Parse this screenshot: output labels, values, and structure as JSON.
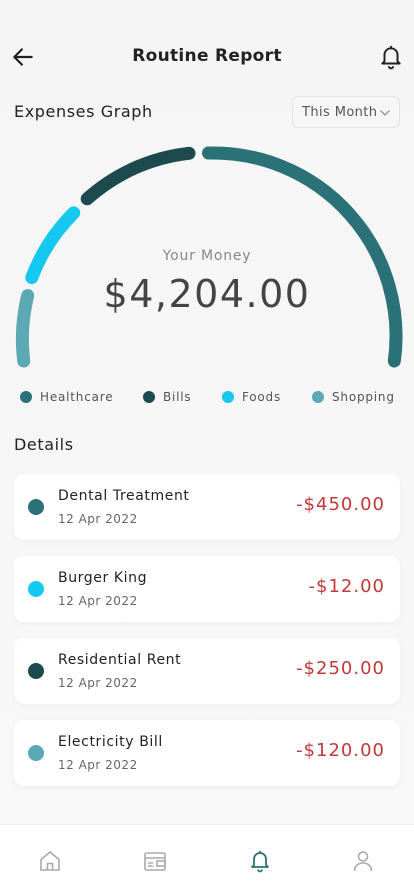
{
  "header": {
    "title": "Routine Report",
    "back_icon": "arrow-left-icon",
    "bell_icon": "bell-icon"
  },
  "expenses": {
    "title": "Expenses Graph",
    "period": "This Month"
  },
  "summary": {
    "label": "Your Money",
    "value": "$4,204.00"
  },
  "categories": [
    {
      "name": "Healthcare",
      "color": "#2b7178"
    },
    {
      "name": "Bills",
      "color": "#1d4a4f"
    },
    {
      "name": "Foods",
      "color": "#14c8ef"
    },
    {
      "name": "Shopping",
      "color": "#5aa9b4"
    }
  ],
  "details": {
    "title": "Details",
    "items": [
      {
        "name": "Dental Treatment",
        "date": "12 Apr 2022",
        "amount": "-$450.00",
        "color": "#2b7178"
      },
      {
        "name": "Burger King",
        "date": "12 Apr 2022",
        "amount": "-$12.00",
        "color": "#14c8ef"
      },
      {
        "name": "Residential Rent",
        "date": "12 Apr 2022",
        "amount": "-$250.00",
        "color": "#1d4a4f"
      },
      {
        "name": "Electricity Bill",
        "date": "12 Apr 2022",
        "amount": "-$120.00",
        "color": "#5aa9b4"
      }
    ]
  },
  "nav": {
    "items": [
      "home-icon",
      "wallet-icon",
      "bell-icon",
      "user-icon"
    ],
    "active": "bell-icon",
    "active_color": "#2b7178",
    "inactive_color": "#aaaaaa"
  }
}
